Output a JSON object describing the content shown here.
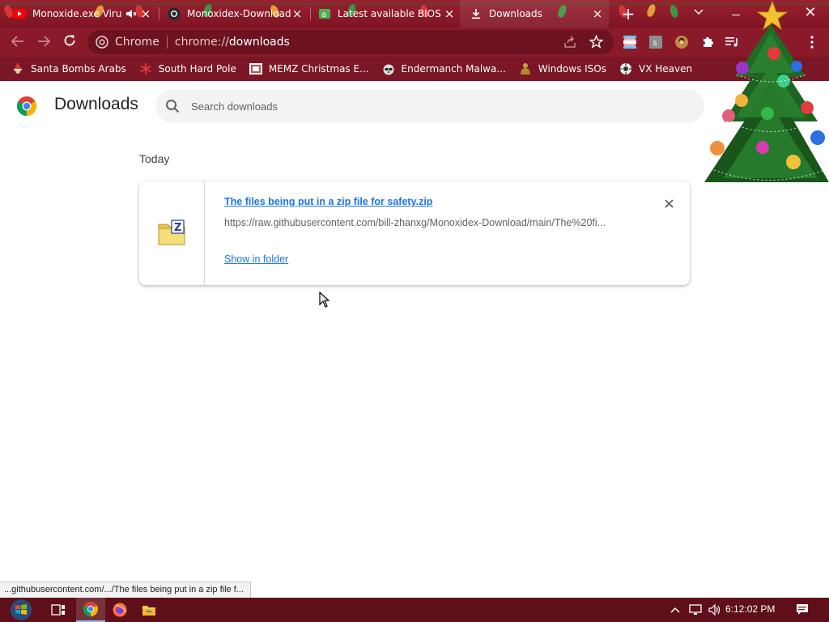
{
  "tabs": [
    {
      "title": "Monoxide.exe Viru",
      "icon": "youtube-icon"
    },
    {
      "title": "Monoxidex-Download",
      "icon": "github-icon"
    },
    {
      "title": "Latest available BIOS v",
      "icon": "bios-icon"
    },
    {
      "title": "Downloads",
      "icon": "download-icon",
      "active": true
    }
  ],
  "toolbar": {
    "site_label": "Chrome",
    "url_scheme": "chrome://",
    "url_path": "downloads"
  },
  "bookmarks": [
    {
      "label": "Santa Bombs Arabs",
      "icon": "santa-icon"
    },
    {
      "label": "South Hard Pole",
      "icon": "snowflake-icon"
    },
    {
      "label": "MEMZ Christmas E...",
      "icon": "memz-icon"
    },
    {
      "label": "Endermanch Malwa...",
      "icon": "raccoon-icon"
    },
    {
      "label": "Windows ISOs",
      "icon": "buddha-icon"
    },
    {
      "label": "VX Heaven",
      "icon": "vx-icon"
    }
  ],
  "page": {
    "title": "Downloads",
    "search_placeholder": "Search downloads",
    "date_heading": "Today"
  },
  "download": {
    "file_name": "The files being put in a zip file for safety.zip",
    "url": "https://raw.githubusercontent.com/bill-zhanxg/Monoxidex-Download/main/The%20fi...",
    "show_in_folder": "Show in folder"
  },
  "status_bubble": "...githubusercontent.com/.../The files being put in a zip file f...",
  "taskbar": {
    "clock": "6:12:02 PM"
  },
  "colors": {
    "tab_strip": "#8a1a2a",
    "link_blue": "#1a73e8",
    "taskbar": "#5e0f19"
  }
}
